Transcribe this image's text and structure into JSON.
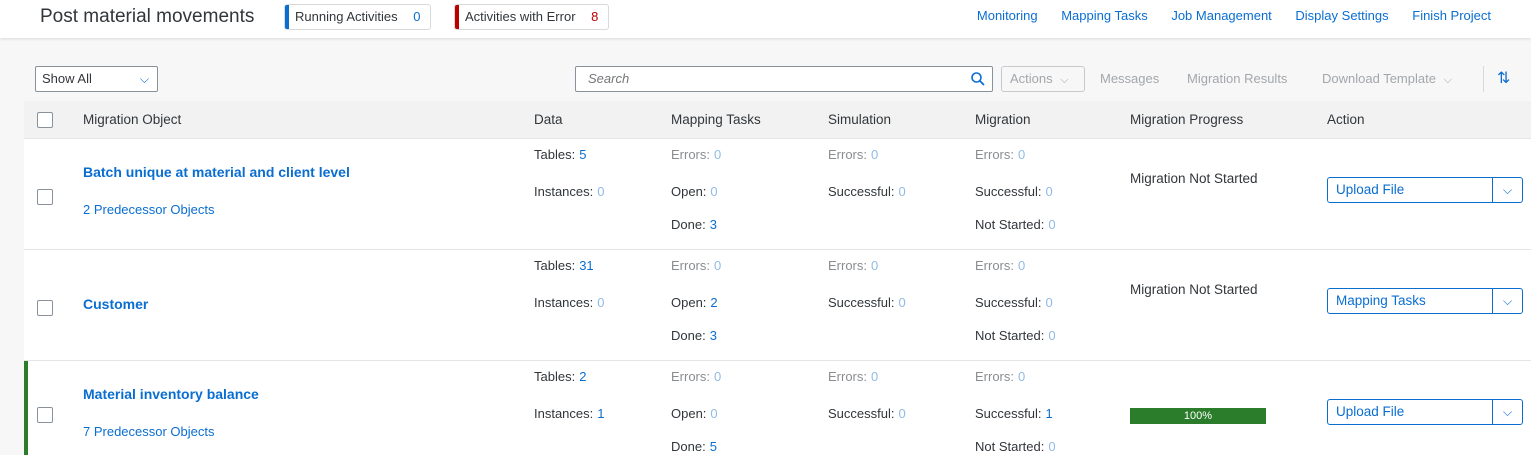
{
  "header": {
    "title": "Post material movements",
    "running_label": "Running Activities",
    "running_count": "0",
    "error_label": "Activities with Error",
    "error_count": "8",
    "links": [
      "Monitoring",
      "Mapping Tasks",
      "Job Management",
      "Display Settings",
      "Finish Project"
    ]
  },
  "toolbar": {
    "filter_value": "Show All",
    "search_placeholder": "Search",
    "actions_label": "Actions",
    "messages_label": "Messages",
    "migration_results_label": "Migration Results",
    "download_template_label": "Download Template"
  },
  "table": {
    "columns": [
      "Migration Object",
      "Data",
      "Mapping Tasks",
      "Simulation",
      "Migration",
      "Migration Progress",
      "Action"
    ],
    "rows": [
      {
        "name": "Batch unique at material and client level",
        "predecessors": "2 Predecessor Objects",
        "tables_label": "Tables:",
        "tables": "5",
        "instances_label": "Instances:",
        "instances": "0",
        "map_errors_label": "Errors:",
        "map_errors": "0",
        "map_open_label": "Open:",
        "map_open": "0",
        "map_done_label": "Done:",
        "map_done": "3",
        "sim_errors_label": "Errors:",
        "sim_errors": "0",
        "sim_success_label": "Successful:",
        "sim_success": "0",
        "mig_errors_label": "Errors:",
        "mig_errors": "0",
        "mig_success_label": "Successful:",
        "mig_success": "0",
        "mig_not_started_label": "Not Started:",
        "mig_not_started": "0",
        "progress_text": "Migration Not Started",
        "action": "Upload File"
      },
      {
        "name": "Customer",
        "predecessors": "",
        "tables_label": "Tables:",
        "tables": "31",
        "instances_label": "Instances:",
        "instances": "0",
        "map_errors_label": "Errors:",
        "map_errors": "0",
        "map_open_label": "Open:",
        "map_open": "2",
        "map_done_label": "Done:",
        "map_done": "3",
        "sim_errors_label": "Errors:",
        "sim_errors": "0",
        "sim_success_label": "Successful:",
        "sim_success": "0",
        "mig_errors_label": "Errors:",
        "mig_errors": "0",
        "mig_success_label": "Successful:",
        "mig_success": "0",
        "mig_not_started_label": "Not Started:",
        "mig_not_started": "0",
        "progress_text": "Migration Not Started",
        "action": "Mapping Tasks"
      },
      {
        "name": "Material inventory balance",
        "predecessors": "7 Predecessor Objects",
        "tables_label": "Tables:",
        "tables": "2",
        "instances_label": "Instances:",
        "instances": "1",
        "map_errors_label": "Errors:",
        "map_errors": "0",
        "map_open_label": "Open:",
        "map_open": "0",
        "map_done_label": "Done:",
        "map_done": "5",
        "sim_errors_label": "Errors:",
        "sim_errors": "0",
        "sim_success_label": "Successful:",
        "sim_success": "0",
        "mig_errors_label": "Errors:",
        "mig_errors": "0",
        "mig_success_label": "Successful:",
        "mig_success": "1",
        "mig_not_started_label": "Not Started:",
        "mig_not_started": "0",
        "progress_percent": "100%",
        "action": "Upload File"
      }
    ]
  },
  "colors": {
    "link": "#0a6ed1",
    "running": "#0a6ed1",
    "error": "#bb0000",
    "success": "#2b7d2b"
  }
}
